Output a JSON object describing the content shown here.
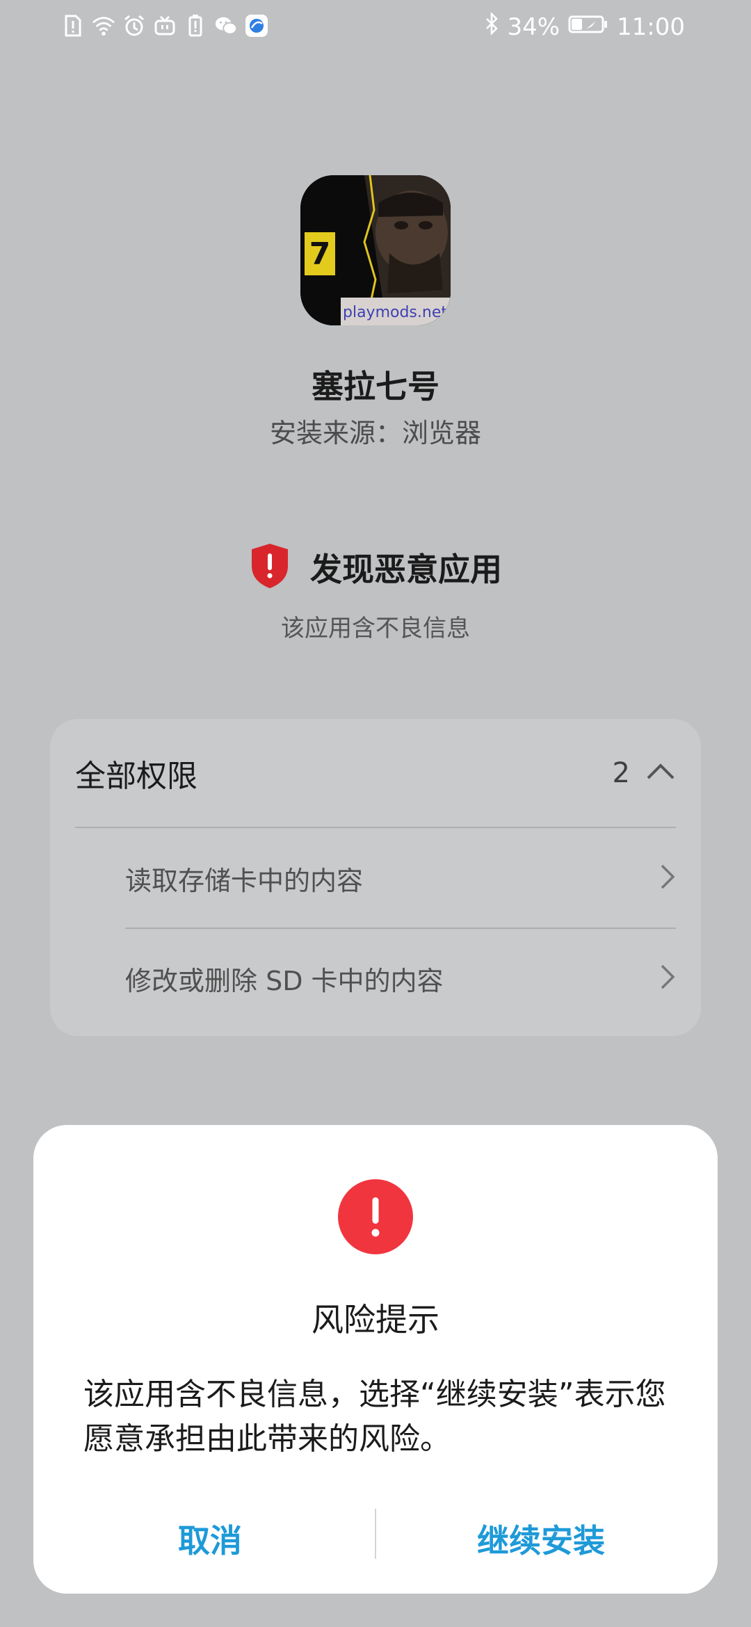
{
  "status_bar": {
    "left_icons": [
      "sim-alert-icon",
      "wifi-icon",
      "alarm-icon",
      "tv-icon",
      "battery-saver-icon",
      "wechat-icon",
      "browser-icon"
    ],
    "bluetooth_icon": "bluetooth-icon",
    "battery_percent": "34%",
    "time": "11:00"
  },
  "app": {
    "name": "塞拉七号",
    "source": "安装来源：浏览器",
    "icon_badge": "7",
    "icon_watermark": "playmods.net"
  },
  "risk": {
    "title": "发现恶意应用",
    "subtitle": "该应用含不良信息",
    "colors": {
      "shield": "#d8262c"
    }
  },
  "permissions": {
    "title": "全部权限",
    "count": "2",
    "items": [
      {
        "label": "读取存储卡中的内容"
      },
      {
        "label": "修改或删除 SD 卡中的内容"
      }
    ]
  },
  "dialog": {
    "title": "风险提示",
    "message": "该应用含不良信息，选择“继续安装”表示您愿意承担由此带来的风险。",
    "cancel_label": "取消",
    "confirm_label": "继续安装",
    "colors": {
      "accent": "#1e9ad8",
      "alert": "#f0353e"
    }
  }
}
